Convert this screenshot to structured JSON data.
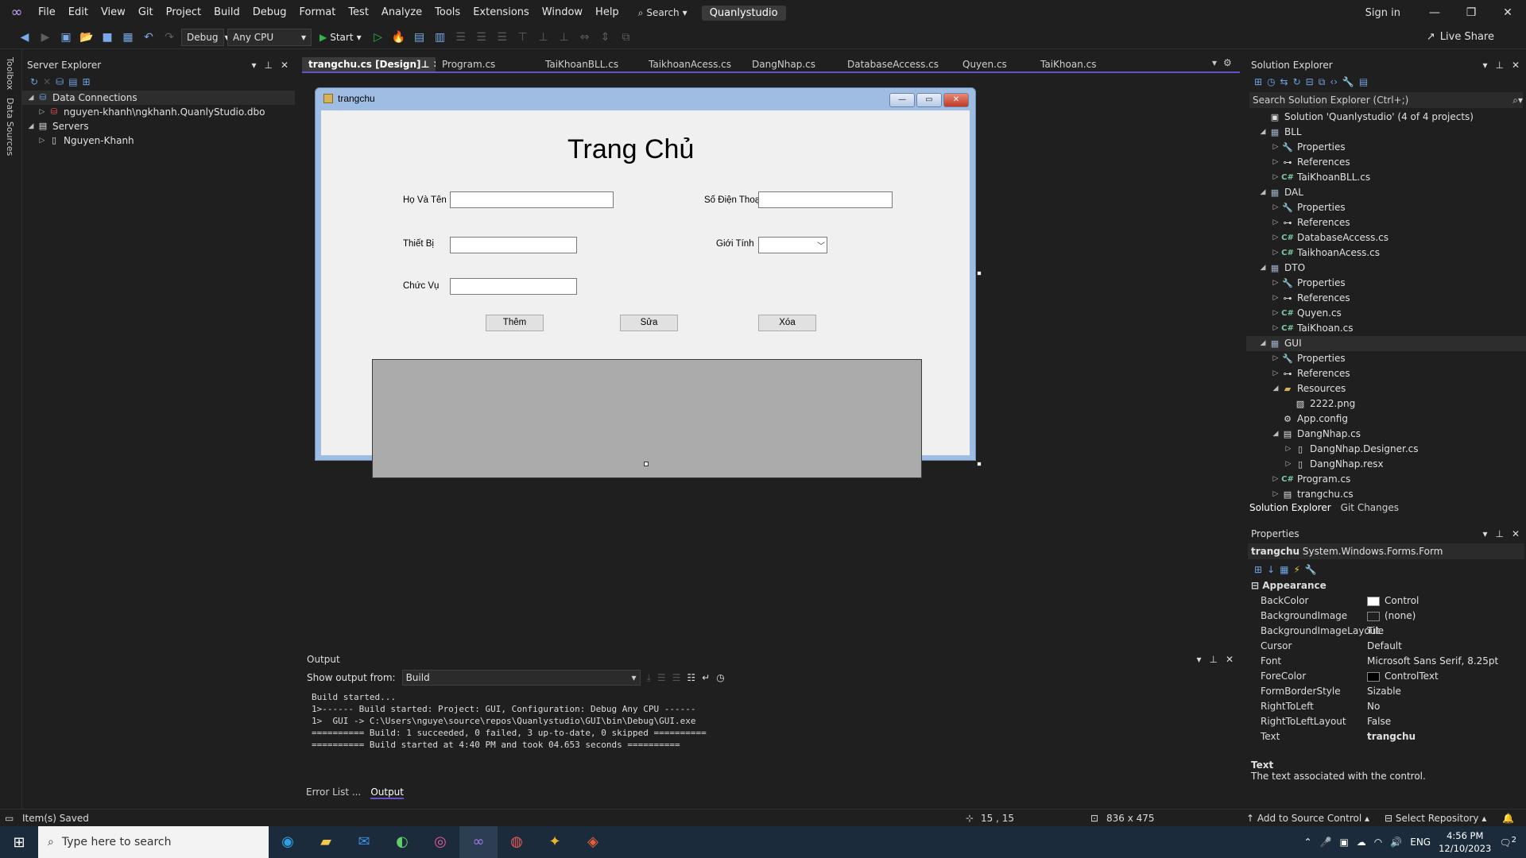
{
  "menubar": {
    "items": [
      "File",
      "Edit",
      "View",
      "Git",
      "Project",
      "Build",
      "Debug",
      "Format",
      "Test",
      "Analyze",
      "Tools",
      "Extensions",
      "Window",
      "Help"
    ],
    "search_label": "Search",
    "solution_name": "Quanlystudio",
    "sign_in": "Sign in"
  },
  "toolbar": {
    "config": "Debug",
    "platform": "Any CPU",
    "start": "Start",
    "live_share": "Live Share"
  },
  "left_strip": {
    "toolbox": "Toolbox",
    "data_sources": "Data Sources"
  },
  "server_explorer": {
    "title": "Server Explorer",
    "tree": [
      {
        "label": "Data Connections",
        "level": 0,
        "expanded": true
      },
      {
        "label": "nguyen-khanh\\ngkhanh.QuanlyStudio.dbo",
        "level": 1,
        "expanded": false
      },
      {
        "label": "Servers",
        "level": 0,
        "expanded": true
      },
      {
        "label": "Nguyen-Khanh",
        "level": 1,
        "expanded": false
      }
    ]
  },
  "tabs": [
    {
      "label": "trangchu.cs [Design]",
      "active": true
    },
    {
      "label": "Program.cs"
    },
    {
      "label": "TaiKhoanBLL.cs"
    },
    {
      "label": "TaikhoanAcess.cs"
    },
    {
      "label": "DangNhap.cs"
    },
    {
      "label": "DatabaseAccess.cs"
    },
    {
      "label": "Quyen.cs"
    },
    {
      "label": "TaiKhoan.cs"
    }
  ],
  "form": {
    "window_title": "trangchu",
    "heading": "Trang Chủ",
    "labels": {
      "ho_va_ten": "Họ Và Tên",
      "so_dien_thoai": "Số Điện Thoại",
      "thiet_bi": "Thiết Bị",
      "gioi_tinh": "Giới Tính",
      "chuc_vu": "Chức Vụ"
    },
    "buttons": {
      "them": "Thêm",
      "sua": "Sửa",
      "xoa": "Xóa"
    }
  },
  "output": {
    "title": "Output",
    "show_from_label": "Show output from:",
    "source": "Build",
    "lines": [
      "Build started...",
      "1>------ Build started: Project: GUI, Configuration: Debug Any CPU ------",
      "1>  GUI -> C:\\Users\\nguye\\source\\repos\\Quanlystudio\\GUI\\bin\\Debug\\GUI.exe",
      "========== Build: 1 succeeded, 0 failed, 3 up-to-date, 0 skipped ==========",
      "========== Build started at 4:40 PM and took 04.653 seconds =========="
    ],
    "tabs": [
      "Error List ...",
      "Output"
    ]
  },
  "solution_explorer": {
    "title": "Solution Explorer",
    "search_placeholder": "Search Solution Explorer (Ctrl+;)",
    "tree": [
      {
        "label": "Solution 'Quanlystudio' (4 of 4 projects)",
        "level": 0,
        "icon": "solution"
      },
      {
        "label": "BLL",
        "level": 0,
        "icon": "project",
        "expanded": true
      },
      {
        "label": "Properties",
        "level": 1,
        "icon": "wrench"
      },
      {
        "label": "References",
        "level": 1,
        "icon": "refs"
      },
      {
        "label": "TaiKhoanBLL.cs",
        "level": 1,
        "icon": "cs"
      },
      {
        "label": "DAL",
        "level": 0,
        "icon": "project",
        "expanded": true
      },
      {
        "label": "Properties",
        "level": 1,
        "icon": "wrench"
      },
      {
        "label": "References",
        "level": 1,
        "icon": "refs"
      },
      {
        "label": "DatabaseAccess.cs",
        "level": 1,
        "icon": "cs"
      },
      {
        "label": "TaikhoanAcess.cs",
        "level": 1,
        "icon": "cs"
      },
      {
        "label": "DTO",
        "level": 0,
        "icon": "project",
        "expanded": true
      },
      {
        "label": "Properties",
        "level": 1,
        "icon": "wrench"
      },
      {
        "label": "References",
        "level": 1,
        "icon": "refs"
      },
      {
        "label": "Quyen.cs",
        "level": 1,
        "icon": "cs"
      },
      {
        "label": "TaiKhoan.cs",
        "level": 1,
        "icon": "cs"
      },
      {
        "label": "GUI",
        "level": 0,
        "icon": "project",
        "expanded": true,
        "selected": true
      },
      {
        "label": "Properties",
        "level": 1,
        "icon": "wrench"
      },
      {
        "label": "References",
        "level": 1,
        "icon": "refs"
      },
      {
        "label": "Resources",
        "level": 1,
        "icon": "folder",
        "expanded": true
      },
      {
        "label": "2222.png",
        "level": 2,
        "icon": "image"
      },
      {
        "label": "App.config",
        "level": 1,
        "icon": "config"
      },
      {
        "label": "DangNhap.cs",
        "level": 1,
        "icon": "form",
        "expanded": true
      },
      {
        "label": "DangNhap.Designer.cs",
        "level": 2,
        "icon": "file"
      },
      {
        "label": "DangNhap.resx",
        "level": 2,
        "icon": "file"
      },
      {
        "label": "Program.cs",
        "level": 1,
        "icon": "cs"
      },
      {
        "label": "trangchu.cs",
        "level": 1,
        "icon": "form"
      }
    ],
    "tabs": [
      "Solution Explorer",
      "Git Changes"
    ]
  },
  "properties": {
    "title": "Properties",
    "object": "trangchu",
    "object_type": "System.Windows.Forms.Form",
    "category": "Appearance",
    "rows": [
      {
        "name": "BackColor",
        "value": "Control",
        "swatch": "#ffffff"
      },
      {
        "name": "BackgroundImage",
        "value": "(none)",
        "swatch": "#1f1f1f"
      },
      {
        "name": "BackgroundImageLayout",
        "value": "Tile"
      },
      {
        "name": "Cursor",
        "value": "Default"
      },
      {
        "name": "Font",
        "value": "Microsoft Sans Serif, 8.25pt"
      },
      {
        "name": "ForeColor",
        "value": "ControlText",
        "swatch": "#000000"
      },
      {
        "name": "FormBorderStyle",
        "value": "Sizable"
      },
      {
        "name": "RightToLeft",
        "value": "No"
      },
      {
        "name": "RightToLeftLayout",
        "value": "False"
      },
      {
        "name": "Text",
        "value": "trangchu"
      }
    ],
    "desc_title": "Text",
    "desc_text": "The text associated with the control."
  },
  "statusbar": {
    "message": "Item(s) Saved",
    "position": "15 , 15",
    "size": "836 x 475",
    "source_control": "Add to Source Control",
    "repository": "Select Repository"
  },
  "taskbar": {
    "search_placeholder": "Type here to search",
    "language": "ENG",
    "time": "4:56 PM",
    "date": "12/10/2023",
    "notifications": "2"
  }
}
